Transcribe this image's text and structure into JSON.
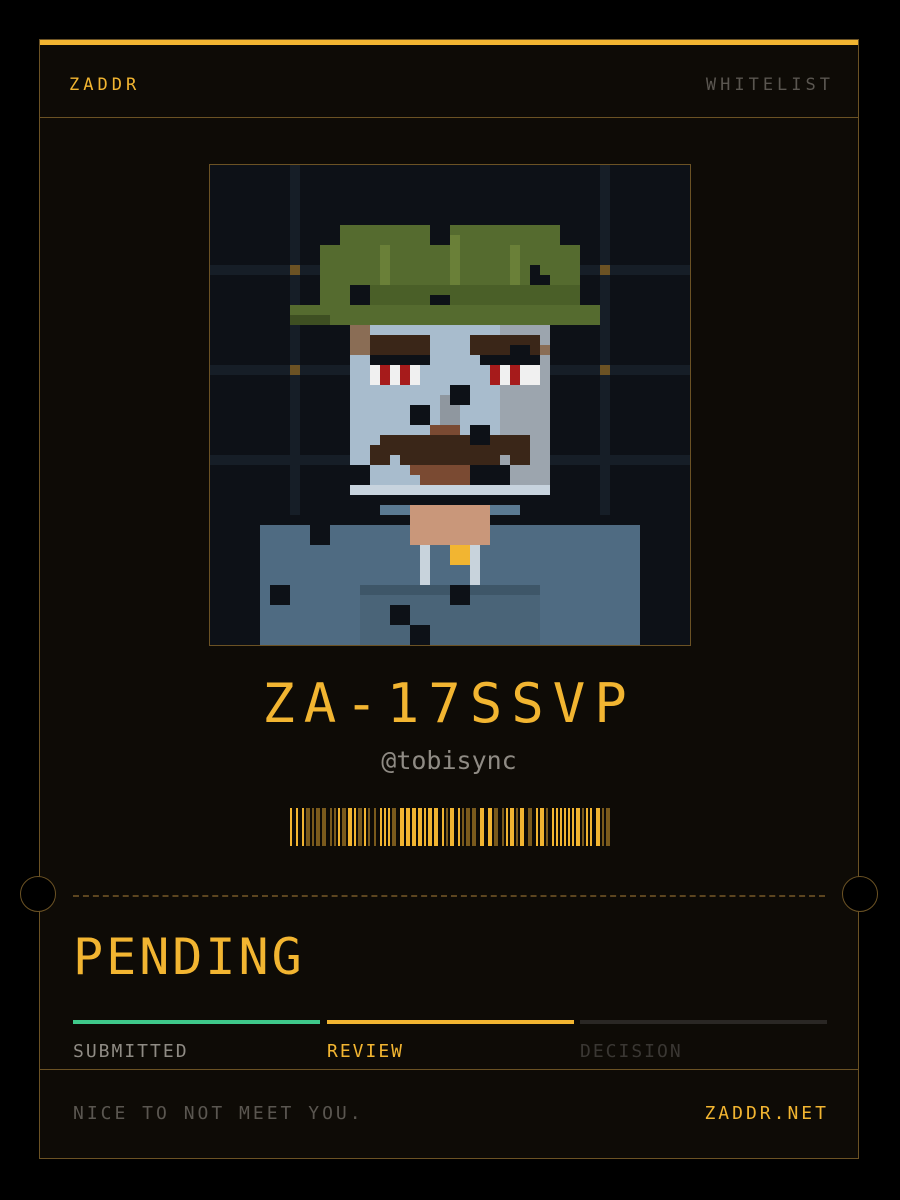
{
  "header": {
    "brand": "ZADDR",
    "tier": "WHITELIST"
  },
  "avatar": {
    "label": "pixel-art-portrait"
  },
  "pass": {
    "code": "ZA-17SSVP",
    "handle": "@tobisync"
  },
  "status": {
    "label": "PENDING"
  },
  "steps": [
    {
      "label": "SUBMITTED",
      "state": "done",
      "color": "#3fc98a"
    },
    {
      "label": "REVIEW",
      "state": "active",
      "color": "#f2b531"
    },
    {
      "label": "DECISION",
      "state": "upcoming",
      "color": "#2a2724"
    }
  ],
  "footer": {
    "tagline": "NICE TO NOT MEET YOU.",
    "site": "ZADDR.NET"
  },
  "colors": {
    "accent": "#f2b531",
    "border": "#6b5224",
    "done": "#3fc98a",
    "muted": "#5a5650"
  }
}
